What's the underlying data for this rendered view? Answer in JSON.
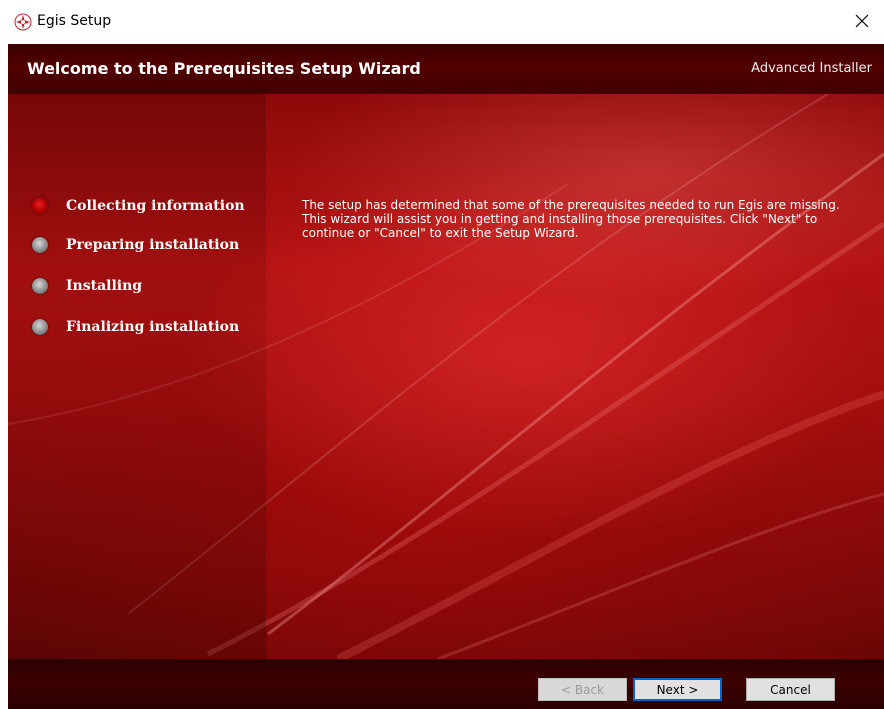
{
  "window": {
    "title": "Egis Setup",
    "close_icon": "close-icon"
  },
  "header": {
    "title": "Welcome to the Prerequisites Setup Wizard",
    "brand": "Advanced Installer"
  },
  "steps": [
    {
      "label": "Collecting information",
      "state": "active"
    },
    {
      "label": "Preparing installation",
      "state": "pending"
    },
    {
      "label": "Installing",
      "state": "pending"
    },
    {
      "label": "Finalizing installation",
      "state": "pending"
    }
  ],
  "message": {
    "lines": [
      "The setup has determined that some of the prerequisites needed to run Egis are missing.",
      "This wizard will assist you in getting and installing those prerequisites. Click \"Next\" to",
      "continue or \"Cancel\" to exit the Setup Wizard."
    ]
  },
  "buttons": {
    "back": "< Back",
    "next": "Next >",
    "cancel": "Cancel"
  },
  "colors": {
    "accent": "#b41212",
    "header_bg": "#530000",
    "step_active": "#c00000",
    "step_inactive": "#8c8c8c",
    "focus_border": "#0a64c8"
  }
}
